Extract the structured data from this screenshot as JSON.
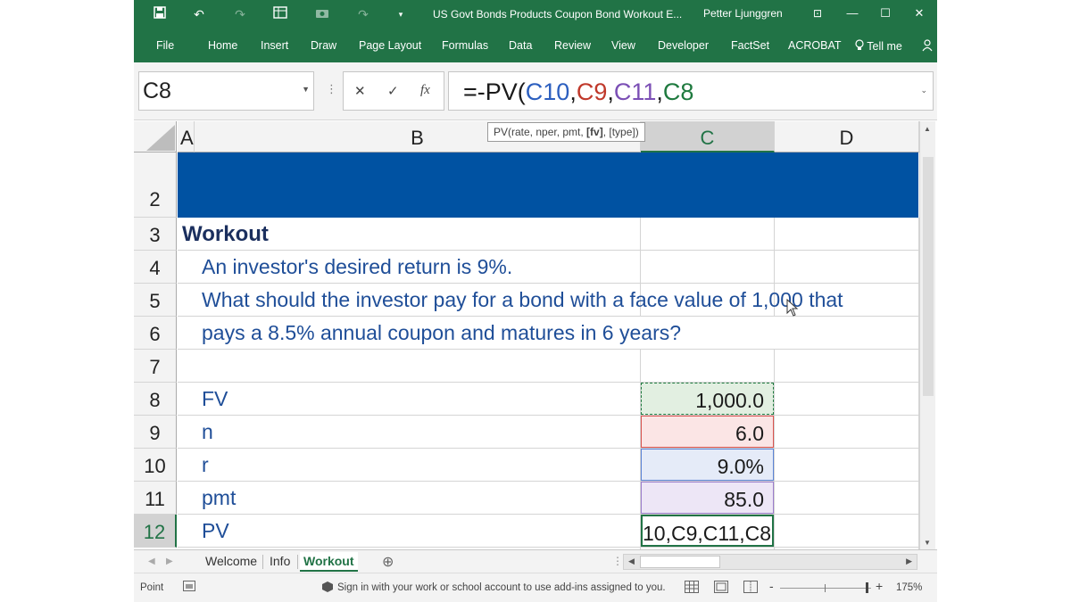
{
  "titlebar": {
    "title": "US Govt Bonds Products Coupon Bond Workout E...",
    "user": "Petter Ljunggren",
    "save_icon": "save-icon",
    "undo_icon": "undo-icon",
    "redo_icon": "redo-icon",
    "minimize": "—",
    "maximize": "☐",
    "close": "✕",
    "ribbon_display": "⊡"
  },
  "ribbon": {
    "tabs": [
      "File",
      "Home",
      "Insert",
      "Draw",
      "Page Layout",
      "Formulas",
      "Data",
      "Review",
      "View",
      "Developer",
      "FactSet",
      "ACROBAT"
    ],
    "tell_me": "Tell me",
    "share_icon": "share-icon"
  },
  "formula_bar": {
    "name_box": "C8",
    "cancel": "✕",
    "enter": "✓",
    "fx": "fx",
    "formula_parts": [
      {
        "text": "=-PV(",
        "color": "#1a1a1a"
      },
      {
        "text": "C10",
        "color": "#2c5fbf"
      },
      {
        "text": ",",
        "color": "#1a1a1a"
      },
      {
        "text": "C9",
        "color": "#c0392b"
      },
      {
        "text": ",",
        "color": "#1a1a1a"
      },
      {
        "text": "C11",
        "color": "#7b4fb5"
      },
      {
        "text": ",",
        "color": "#1a1a1a"
      },
      {
        "text": "C8",
        "color": "#1f7a3f"
      }
    ]
  },
  "tooltip": {
    "prefix": "PV(rate, nper, pmt, ",
    "bold": "[fv]",
    "suffix": ", [type])"
  },
  "columns": [
    "A",
    "B",
    "C",
    "D"
  ],
  "rows": [
    "2",
    "3",
    "4",
    "5",
    "6",
    "7",
    "8",
    "9",
    "10",
    "11",
    "12"
  ],
  "sheet": {
    "heading": "Workout",
    "line1": "An investor's desired return is 9%.",
    "line2": "What should the investor pay for a bond with a face value of 1,000 that",
    "line3": "pays a 8.5% annual coupon and matures in 6 years?",
    "labels": [
      "FV",
      "n",
      "r",
      "pmt",
      "PV"
    ],
    "values": [
      "1,000.0",
      "6.0",
      "9.0%",
      "85.0",
      "10,C9,C11,C8"
    ]
  },
  "colors": {
    "excel_green": "#217346",
    "banner_blue": "#0052a2",
    "fv_fill": "#e2efe1",
    "n_fill": "#fbe5e5",
    "r_fill": "#e5ebf8",
    "pmt_fill": "#ede6f6"
  },
  "sheet_tabs": [
    "Welcome",
    "Info",
    "Workout"
  ],
  "active_sheet": "Workout",
  "status": {
    "mode": "Point",
    "message": "Sign in with your work or school account to use add-ins assigned to you.",
    "zoom": "175%"
  }
}
